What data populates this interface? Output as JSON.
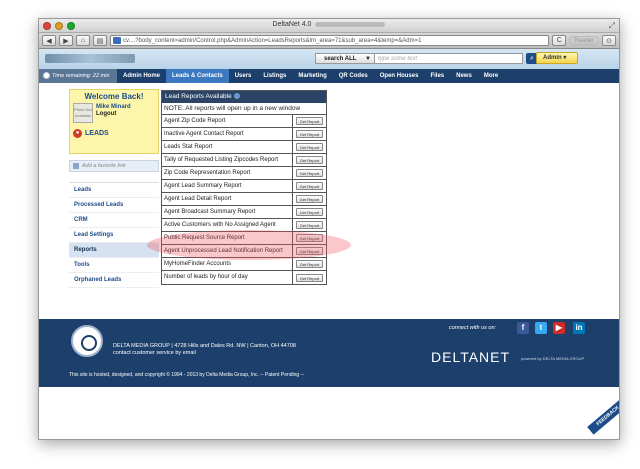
{
  "browser": {
    "title": "DeltaNet 4.0",
    "url": "cv....?body_content=admin/Control.php&AdminAction=LeadsReports&lm_area=71&sub_area=4&temp=&Adm=1",
    "reader_label": "Reader",
    "back_label": "◀",
    "forward_label": "▶",
    "home_label": "⌂",
    "refresh_label": "C"
  },
  "header": {
    "search_scope": "search ALL",
    "search_placeholder": "type some text",
    "admin_label": "Admin"
  },
  "nav": {
    "time_remaining": "Time remaining: 22 min",
    "items": [
      {
        "label": "Admin Home"
      },
      {
        "label": "Leads & Contacts"
      },
      {
        "label": "Users"
      },
      {
        "label": "Listings"
      },
      {
        "label": "Marketing"
      },
      {
        "label": "QR Codes"
      },
      {
        "label": "Open Houses"
      },
      {
        "label": "Files"
      },
      {
        "label": "News"
      },
      {
        "label": "More"
      }
    ]
  },
  "sidebar": {
    "welcome_title": "Welcome Back!",
    "user_name": "Mike Minard",
    "logout_label": "Logout",
    "photo_label": "Photo Not Available",
    "quick_link": "LEADS",
    "add_favorite": "Add a favorite link",
    "menu": [
      {
        "label": "Leads"
      },
      {
        "label": "Processed Leads"
      },
      {
        "label": "CRM"
      },
      {
        "label": "Lead Settings"
      },
      {
        "label": "Reports"
      },
      {
        "label": "Tools"
      },
      {
        "label": "Orphaned Leads"
      }
    ]
  },
  "reports": {
    "title": "Lead Reports Available",
    "note": "NOTE: All reports will open up in a new window",
    "button_label": "Get Report",
    "rows": [
      {
        "name": "Agent Zip Code Report"
      },
      {
        "name": "Inactive Agent Contact Report"
      },
      {
        "name": "Leads Stat Report"
      },
      {
        "name": "Tally of Requested Listing Zipcodes Report"
      },
      {
        "name": "Zip Code Representation Report"
      },
      {
        "name": "Agent Lead Summary Report"
      },
      {
        "name": "Agent Lead Detail Report"
      },
      {
        "name": "Agent Broadcast Summary Report"
      },
      {
        "name": "Active Customers with No Assigned Agent"
      },
      {
        "name": "Public Request Source Report"
      },
      {
        "name": "Agent Unprocessed Lead Notification Report"
      },
      {
        "name": "MyHomeFinder Accounts"
      },
      {
        "name": "Number of leads by hour of day"
      }
    ]
  },
  "footer": {
    "company_line": "DELTA MEDIA GROUP | 4728 Hills and Dales Rd. NW | Canton, OH 44708",
    "contact_line": "contact customer service by email",
    "connect_label": "connect with us on:",
    "brand": "DELTANET",
    "brand_sub": "powered by DELTA MEDIA GROUP",
    "copyright": "This site is hosted, designed, and copyright © 1994 - 2013 by Delta Media Group, Inc. -- Patent Pending --",
    "feedback_label": "FEEDBACK",
    "social": [
      {
        "icon": "facebook-icon",
        "glyph": "f",
        "color": "#3b5998"
      },
      {
        "icon": "twitter-icon",
        "glyph": "t",
        "color": "#33aaf3"
      },
      {
        "icon": "youtube-icon",
        "glyph": "▶",
        "color": "#d12a2a"
      },
      {
        "icon": "linkedin-icon",
        "glyph": "in",
        "color": "#0077b5"
      }
    ]
  }
}
